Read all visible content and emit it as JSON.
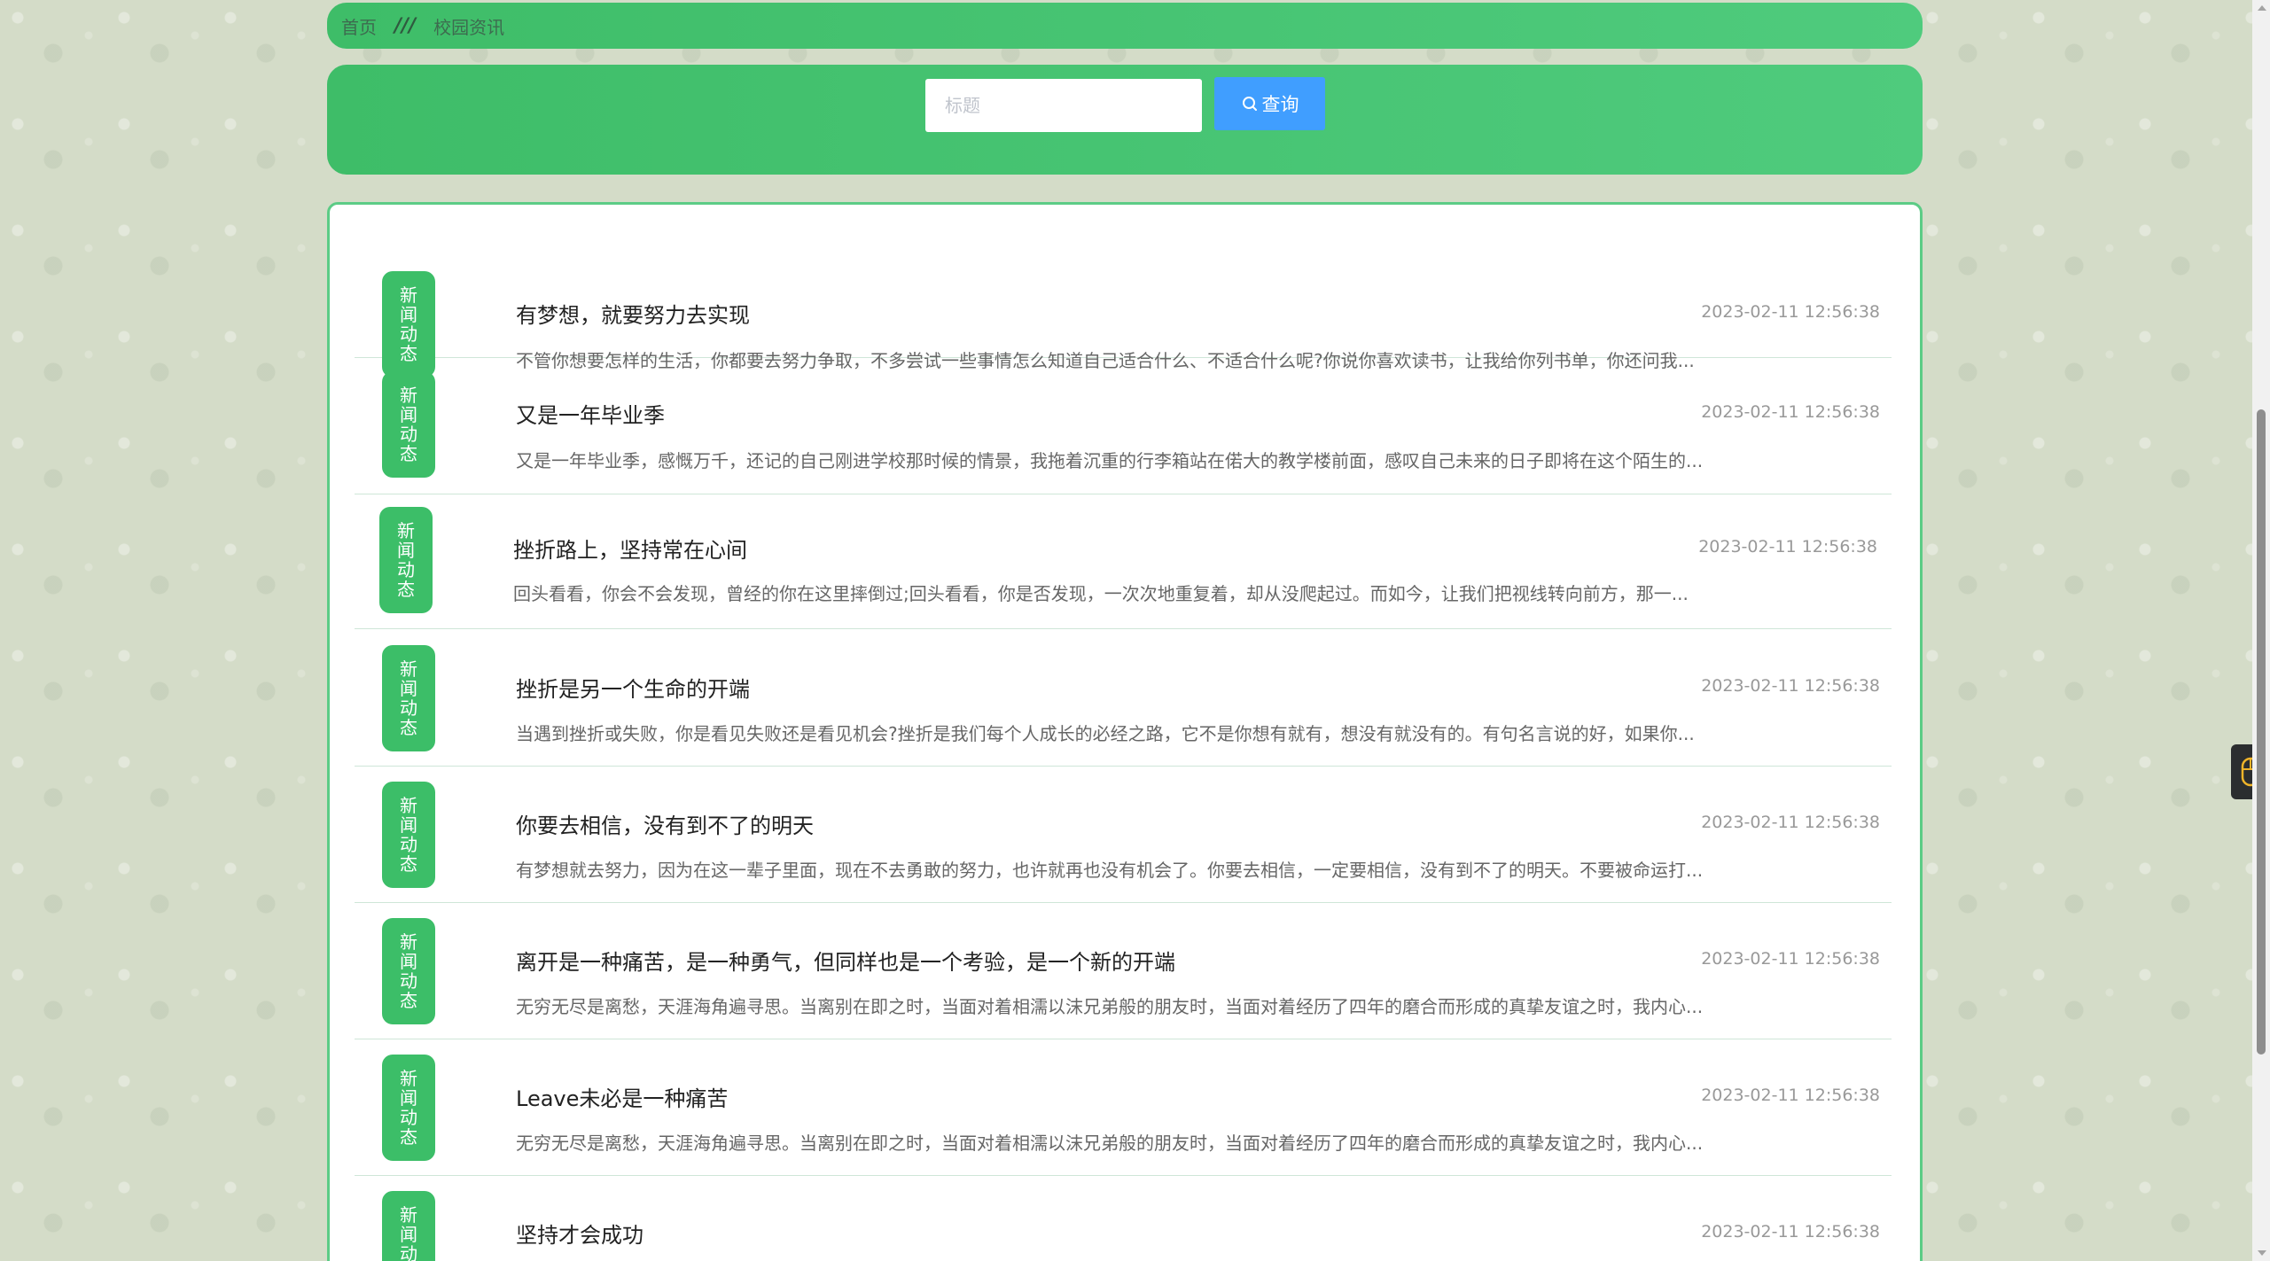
{
  "breadcrumb": {
    "home": "首页",
    "separator": "///",
    "current": "校园资讯"
  },
  "search": {
    "placeholder": "标题",
    "value": "",
    "button_label": "查询"
  },
  "news": [
    {
      "badge": "新闻动态",
      "title": "有梦想，就要努力去实现",
      "date": "2023-02-11 12:56:38",
      "summary": "不管你想要怎样的生活，你都要去努力争取，不多尝试一些事情怎么知道自己适合什么、不适合什么呢?你说你喜欢读书，让我给你列书单，你还问我..."
    },
    {
      "badge": "新闻动态",
      "title": "又是一年毕业季",
      "date": "2023-02-11 12:56:38",
      "summary": "又是一年毕业季，感慨万千，还记的自己刚进学校那时候的情景，我拖着沉重的行李箱站在偌大的教学楼前面，感叹自己未来的日子即将在这个陌生的..."
    },
    {
      "badge": "新闻动态",
      "title": "挫折路上，坚持常在心间",
      "date": "2023-02-11 12:56:38",
      "summary": "回头看看，你会不会发现，曾经的你在这里摔倒过;回头看看，你是否发现，一次次地重复着，却从没爬起过。而如今，让我们把视线转向前方，那一..."
    },
    {
      "badge": "新闻动态",
      "title": "挫折是另一个生命的开端",
      "date": "2023-02-11 12:56:38",
      "summary": "当遇到挫折或失败，你是看见失败还是看见机会?挫折是我们每个人成长的必经之路，它不是你想有就有，想没有就没有的。有句名言说的好，如果你..."
    },
    {
      "badge": "新闻动态",
      "title": "你要去相信，没有到不了的明天",
      "date": "2023-02-11 12:56:38",
      "summary": "有梦想就去努力，因为在这一辈子里面，现在不去勇敢的努力，也许就再也没有机会了。你要去相信，一定要相信，没有到不了的明天。不要被命运打..."
    },
    {
      "badge": "新闻动态",
      "title": "离开是一种痛苦，是一种勇气，但同样也是一个考验，是一个新的开端",
      "date": "2023-02-11 12:56:38",
      "summary": "无穷无尽是离愁，天涯海角遍寻思。当离别在即之时，当面对着相濡以沫兄弟般的朋友时，当面对着经历了四年的磨合而形成的真挚友谊之时，我内心..."
    },
    {
      "badge": "新闻动态",
      "title": "Leave未必是一种痛苦",
      "date": "2023-02-11 12:56:38",
      "summary": "无穷无尽是离愁，天涯海角遍寻思。当离别在即之时，当面对着相濡以沫兄弟般的朋友时，当面对着经历了四年的磨合而形成的真挚友谊之时，我内心..."
    },
    {
      "badge": "新闻动态",
      "title": "坚持才会成功",
      "date": "2023-02-11 12:56:38",
      "summary": ""
    }
  ],
  "colors": {
    "accent_green": "#3cbe68",
    "search_button_blue": "#409eff"
  },
  "icons": {
    "search": "search-icon",
    "side_tool": "mouse-icon"
  }
}
